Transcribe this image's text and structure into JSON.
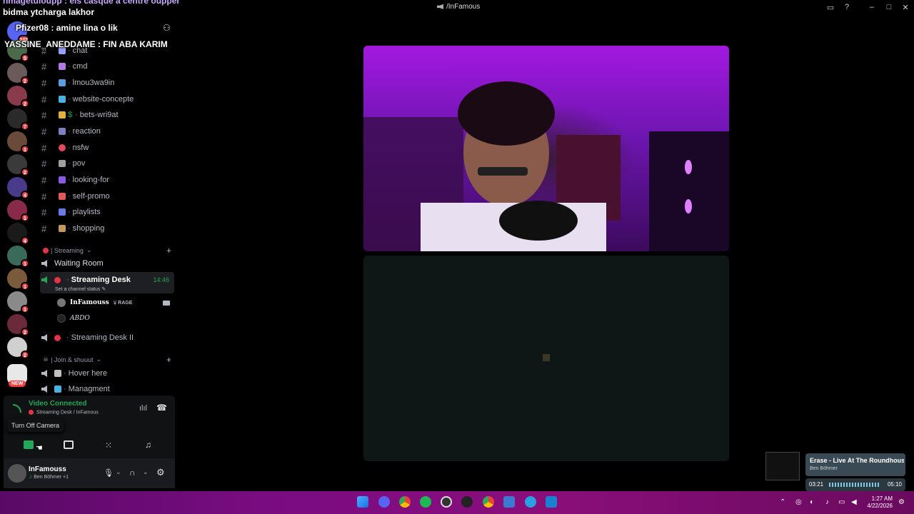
{
  "window": {
    "title": "/InFamous"
  },
  "overlay_chat": [
    {
      "text": "hmagetuloupp : els casque a centre oupper"
    },
    {
      "text": "bidma ytcharga lakhor"
    },
    {
      "text": "Pfizer08 : amine lina o lik"
    },
    {
      "text": "YASSINE_ANEDDAME : FIN ABA KARIM"
    }
  ],
  "servers": [
    {
      "badge": "242"
    },
    {
      "badge": "5"
    },
    {
      "badge": "2"
    },
    {
      "badge": "2"
    },
    {
      "badge": "7"
    },
    {
      "badge": "1"
    },
    {
      "badge": "2"
    },
    {
      "badge": "4"
    },
    {
      "badge": "1"
    },
    {
      "badge": "4"
    },
    {
      "badge": "1"
    },
    {
      "badge": "1"
    },
    {
      "badge": "1"
    },
    {
      "badge": "2"
    },
    {
      "badge": "2"
    }
  ],
  "new_badge": "NEW",
  "channels": [
    {
      "name": "chat"
    },
    {
      "name": "cmd"
    },
    {
      "name": "lmou3wa9in"
    },
    {
      "name": "website-concepte"
    },
    {
      "name": "bets-wri9at"
    },
    {
      "name": "reaction"
    },
    {
      "name": "nsfw"
    },
    {
      "name": "pov"
    },
    {
      "name": "looking-for"
    },
    {
      "name": "self-promo"
    },
    {
      "name": "playlists"
    },
    {
      "name": "shopping"
    }
  ],
  "streaming_category": "| Streaming",
  "waiting_room": "Waiting Room",
  "streaming_desk": {
    "name": "Streaming Desk",
    "timer": "14:46",
    "status_hint": "Set a channel status"
  },
  "voice_members": [
    {
      "name": "InFamouss",
      "tag": "RAGE"
    },
    {
      "name": "ABDO"
    }
  ],
  "streaming_desk_2": "Streaming Desk II",
  "join_category": "| Join & shuuut",
  "join_channels": [
    {
      "name": "Hover here"
    },
    {
      "name": "Managment"
    }
  ],
  "voice_connection": {
    "title": "Video Connected",
    "subtitle": "Streaming Desk / InFamous",
    "tooltip": "Turn Off Camera"
  },
  "user": {
    "name": "InFamouss",
    "status": "Ben Böhmer +1"
  },
  "music": {
    "title": "Erase - Live At The Roundhouse",
    "artist": "Ben Böhmer",
    "elapsed": "03:21",
    "total": "05:10"
  },
  "clock": {
    "time": "1:27 AM",
    "date": "4/22/2026"
  },
  "colors": {
    "online_green": "#23a55a",
    "badge_red": "#f23f43",
    "live_red": "#e5334a",
    "taskbar": "#7a0c82"
  }
}
